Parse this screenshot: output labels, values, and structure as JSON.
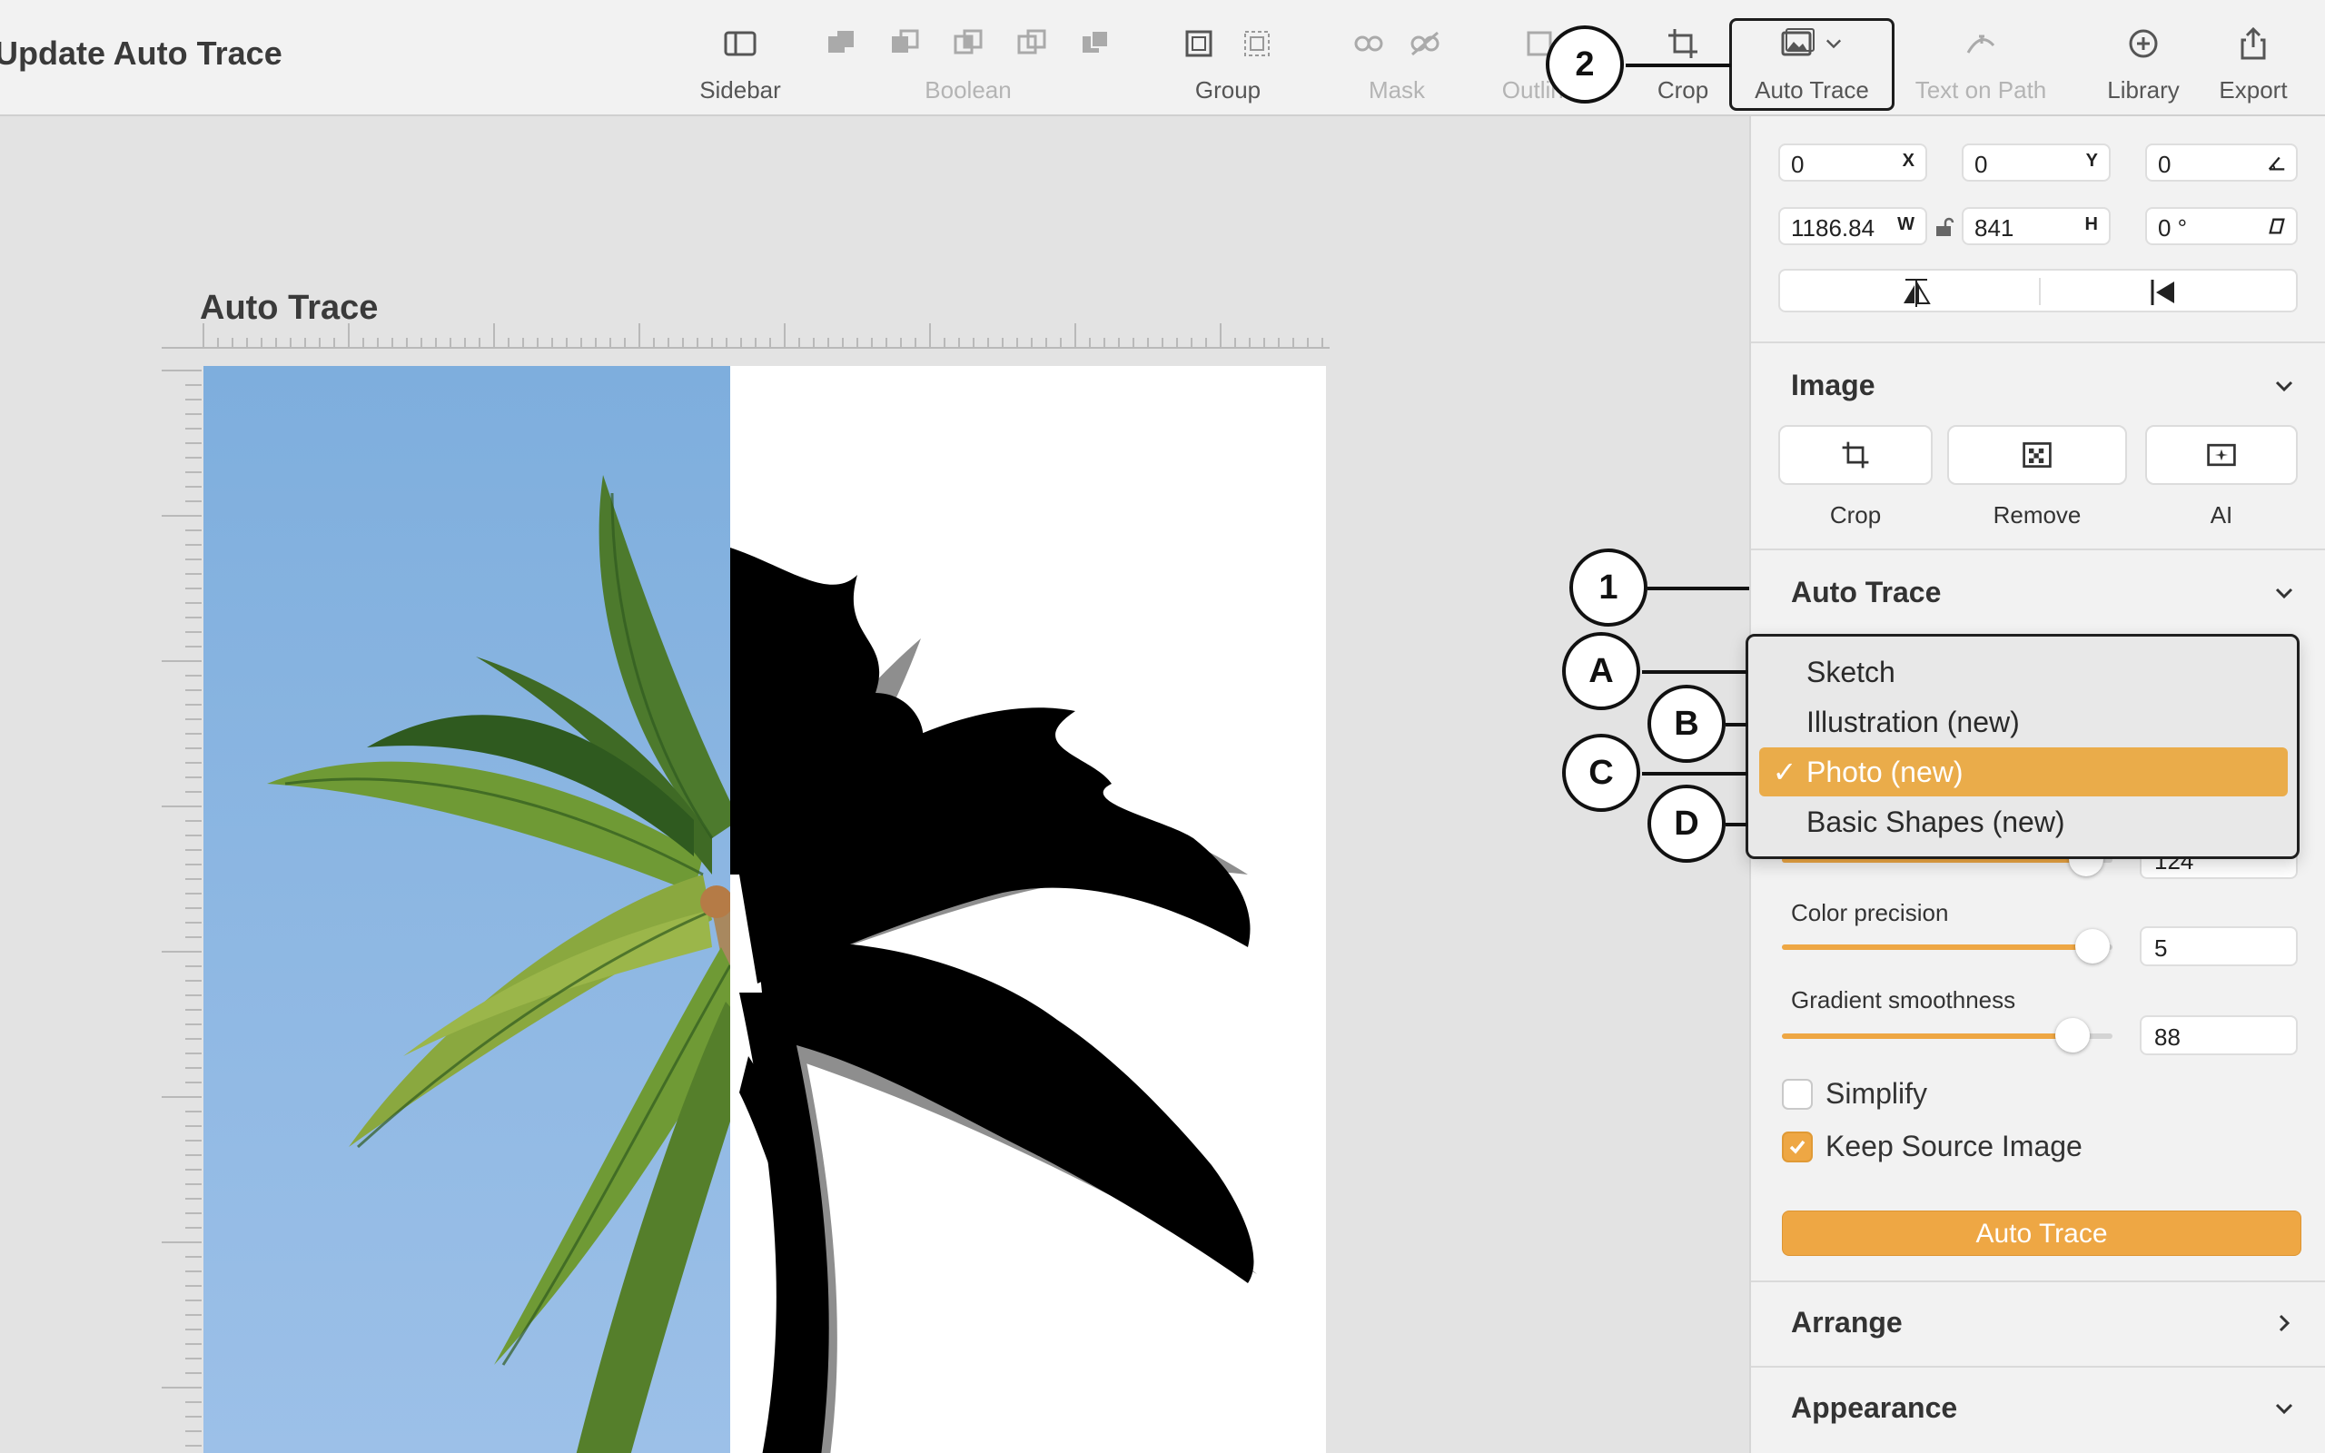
{
  "window": {
    "title": "Update Auto Trace"
  },
  "toolbar": {
    "sidebar": "Sidebar",
    "boolean": "Boolean",
    "group": "Group",
    "mask": "Mask",
    "outline": "Outline",
    "crop": "Crop",
    "auto_trace": "Auto Trace",
    "text_on_path": "Text on Path",
    "library": "Library",
    "export": "Export"
  },
  "canvas": {
    "artboard_title": "Auto Trace"
  },
  "inspector": {
    "geometry": {
      "x": "0",
      "x_label": "X",
      "y": "0",
      "y_label": "Y",
      "angle": "0",
      "w": "1186.84",
      "w_label": "W",
      "h": "841",
      "h_label": "H",
      "rotation": "0 °"
    },
    "image_section": {
      "title": "Image",
      "crop": "Crop",
      "remove": "Remove",
      "ai": "AI"
    },
    "auto_trace_section": {
      "title": "Auto Trace",
      "mode_options": [
        "Sketch",
        "Illustration (new)",
        "Photo (new)",
        "Basic Shapes (new)"
      ],
      "selected_mode": "Photo (new)",
      "hidden_value": "124",
      "color_precision_label": "Color precision",
      "color_precision": "5",
      "color_precision_level": 0.94,
      "gradient_smoothness_label": "Gradient smoothness",
      "gradient_smoothness": "88",
      "gradient_smoothness_level": 0.88,
      "simplify_label": "Simplify",
      "simplify_checked": false,
      "keep_source_label": "Keep Source Image",
      "keep_source_checked": true,
      "button": "Auto Trace"
    },
    "arrange": {
      "title": "Arrange"
    },
    "appearance": {
      "title": "Appearance"
    }
  },
  "callouts": {
    "one": "1",
    "two": "2",
    "a": "A",
    "b": "B",
    "c": "C",
    "d": "D"
  },
  "colors": {
    "accent": "#eea744",
    "sky": "#8fb6e2"
  }
}
